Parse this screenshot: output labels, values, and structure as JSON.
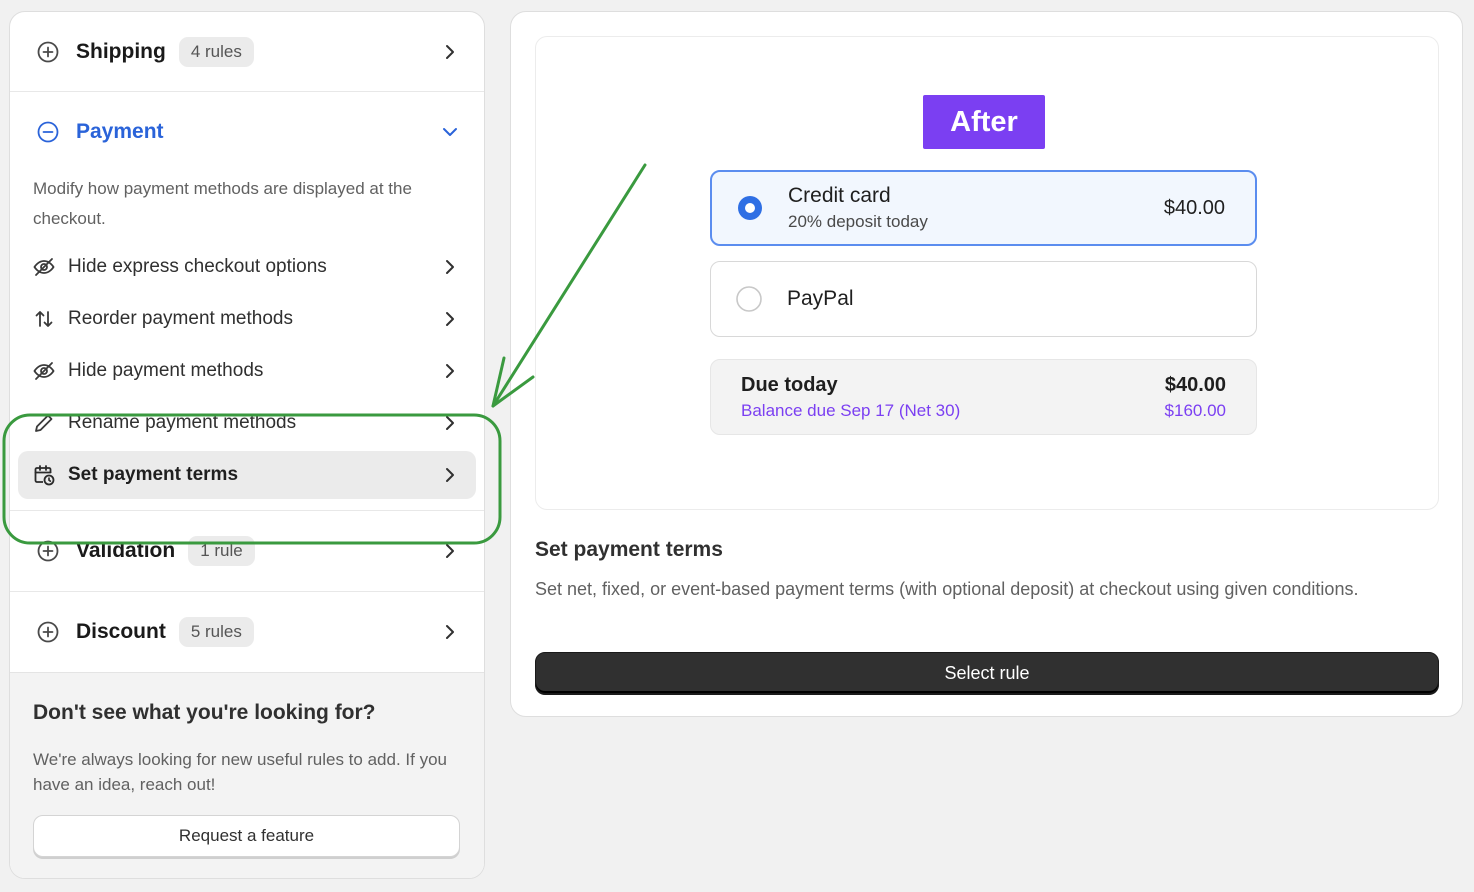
{
  "sidebar": {
    "shipping": {
      "title": "Shipping",
      "badge": "4 rules",
      "icon": "plus-circle-icon"
    },
    "payment": {
      "title": "Payment",
      "icon": "minus-circle-icon",
      "description": "Modify how payment methods are displayed at the checkout.",
      "items": [
        {
          "label": "Hide express checkout options",
          "icon": "eye-slash-icon"
        },
        {
          "label": "Reorder payment methods",
          "icon": "arrows-up-down-icon"
        },
        {
          "label": "Hide payment methods",
          "icon": "eye-slash-icon"
        },
        {
          "label": "Rename payment methods",
          "icon": "pencil-icon"
        },
        {
          "label": "Set payment terms",
          "icon": "calendar-clock-icon",
          "active": true
        }
      ]
    },
    "validation": {
      "title": "Validation",
      "badge": "1 rule",
      "icon": "plus-circle-icon"
    },
    "discount": {
      "title": "Discount",
      "badge": "5 rules",
      "icon": "plus-circle-icon"
    },
    "help": {
      "title": "Don't see what you're looking for?",
      "text": "We're always looking for new useful rules to add. If you have an idea, reach out!",
      "button": "Request a feature"
    }
  },
  "preview": {
    "badge": "After",
    "options": [
      {
        "name": "Credit card",
        "sub": "20% deposit today",
        "price": "$40.00",
        "selected": true
      },
      {
        "name": "PayPal",
        "selected": false
      }
    ],
    "due": {
      "label": "Due today",
      "amount": "$40.00",
      "balance_label": "Balance due Sep 17 (Net 30)",
      "balance_amount": "$160.00"
    }
  },
  "rule": {
    "title": "Set payment terms",
    "description": "Set net, fixed, or event-based payment terms (with optional deposit) at checkout using given conditions.",
    "button": "Select rule"
  },
  "colors": {
    "accent_blue": "#2a63d9",
    "after_purple": "#7b3ff2",
    "annotation_green": "#3a9a3f",
    "primary_button": "#303030"
  }
}
